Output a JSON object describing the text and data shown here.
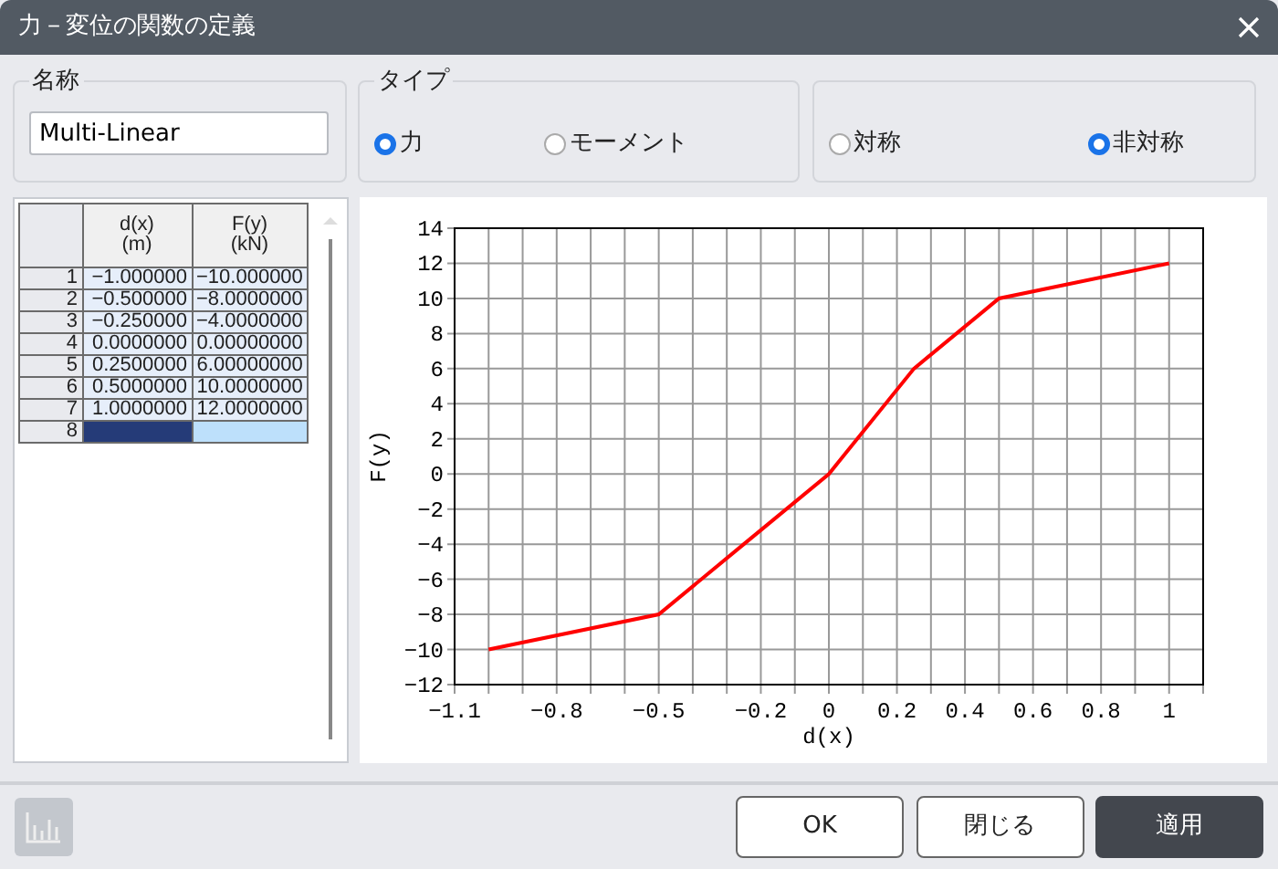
{
  "window": {
    "title": "力－変位の関数の定義"
  },
  "name_group": {
    "legend": "名称",
    "value": "Multi-Linear"
  },
  "type_group": {
    "legend": "タイプ",
    "options": [
      {
        "label": "力",
        "selected": true
      },
      {
        "label": "モーメント",
        "selected": false
      }
    ]
  },
  "symmetry_group": {
    "options": [
      {
        "label": "対称",
        "selected": false
      },
      {
        "label": "非対称",
        "selected": true
      }
    ]
  },
  "table": {
    "columns": [
      "d(x)\n(m)",
      "F(y)\n(kN)"
    ],
    "rows": [
      {
        "number": "1",
        "values": [
          "−1.000000",
          "−10.000000"
        ],
        "selected": false
      },
      {
        "number": "2",
        "values": [
          "−0.500000",
          "−8.0000000"
        ],
        "selected": false
      },
      {
        "number": "3",
        "values": [
          "−0.250000",
          "−4.0000000"
        ],
        "selected": false
      },
      {
        "number": "4",
        "values": [
          "0.0000000",
          "0.00000000"
        ],
        "selected": false
      },
      {
        "number": "5",
        "values": [
          "0.2500000",
          "6.00000000"
        ],
        "selected": false
      },
      {
        "number": "6",
        "values": [
          "0.5000000",
          "10.0000000"
        ],
        "selected": false
      },
      {
        "number": "7",
        "values": [
          "1.0000000",
          "12.0000000"
        ],
        "selected": false
      },
      {
        "number": "8",
        "values": [],
        "selected": true
      }
    ]
  },
  "chart": {
    "chart_data": {
      "type": "line",
      "xlabel": "d(x)",
      "ylabel": "F(y)",
      "xlim": [
        -1.1,
        1.1
      ],
      "ylim": [
        -12,
        14
      ],
      "x": [
        -1,
        -0.5,
        -0.25,
        0,
        0.25,
        0.5,
        1
      ],
      "grid": true,
      "series": [
        {
          "color": "#ff0000",
          "values": [
            -10,
            -8,
            -4,
            0,
            6,
            10,
            12
          ]
        }
      ],
      "xticks": [
        -1.1,
        -0.8,
        -0.5,
        -0.2,
        0,
        0.2,
        0.4,
        0.6,
        0.8,
        1
      ],
      "yticks": [
        -12,
        -10,
        -8,
        -6,
        -4,
        -2,
        0,
        2,
        4,
        6,
        8,
        10,
        12,
        14
      ]
    }
  },
  "buttons": [
    {
      "label": "OK",
      "kind": "default"
    },
    {
      "label": "閉じる",
      "kind": "default"
    },
    {
      "label": "適用",
      "kind": "primary"
    }
  ]
}
